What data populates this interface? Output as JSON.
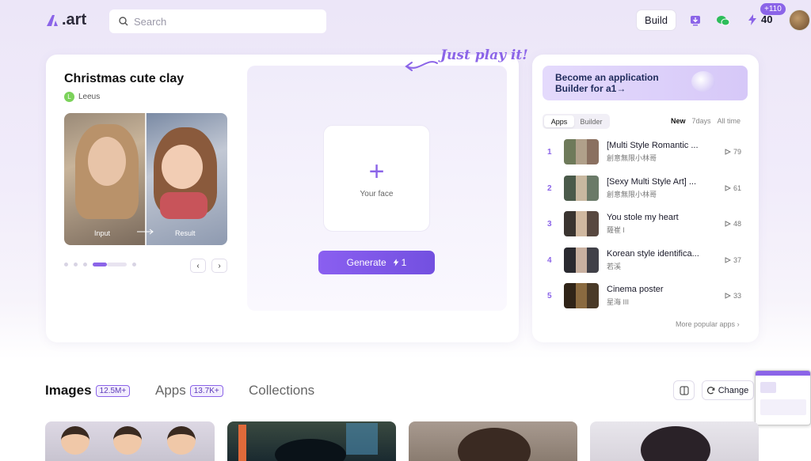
{
  "header": {
    "logo_text": ".art",
    "search_placeholder": "Search",
    "build_label": "Build",
    "credit_badge": "+110",
    "credits": "40"
  },
  "app": {
    "title": "Christmas cute clay",
    "author": "Leeus",
    "author_initial": "L",
    "input_label": "Input",
    "result_label": "Result",
    "upload_label": "Your face",
    "generate_label": "Generate",
    "generate_cost": "1",
    "tagline": "Just play it!"
  },
  "ranking": {
    "banner_line1": "Become an application",
    "banner_line2": "Builder for a1→",
    "tabs": [
      "Apps",
      "Builder"
    ],
    "filters": [
      "New",
      "7days",
      "All time"
    ],
    "items": [
      {
        "rank": "1",
        "title": "[Multi Style Romantic ...",
        "author": "創意無限小林哥",
        "count": "79"
      },
      {
        "rank": "2",
        "title": "[Sexy Multi Style Art] ...",
        "author": "創意無限小林哥",
        "count": "61"
      },
      {
        "rank": "3",
        "title": "You stole my heart",
        "author": "薩崔 l",
        "count": "48"
      },
      {
        "rank": "4",
        "title": "Korean style identifica...",
        "author": "若溪",
        "count": "37"
      },
      {
        "rank": "5",
        "title": "Cinema poster",
        "author": "星海 III",
        "count": "33"
      }
    ],
    "more_label": "More popular apps"
  },
  "tabs": {
    "images_label": "Images",
    "images_count": "12.5M+",
    "apps_label": "Apps",
    "apps_count": "13.7K+",
    "collections_label": "Collections",
    "change_label": "Change"
  },
  "colors": {
    "accent": "#8b64e8",
    "background": "#ece6f8"
  }
}
